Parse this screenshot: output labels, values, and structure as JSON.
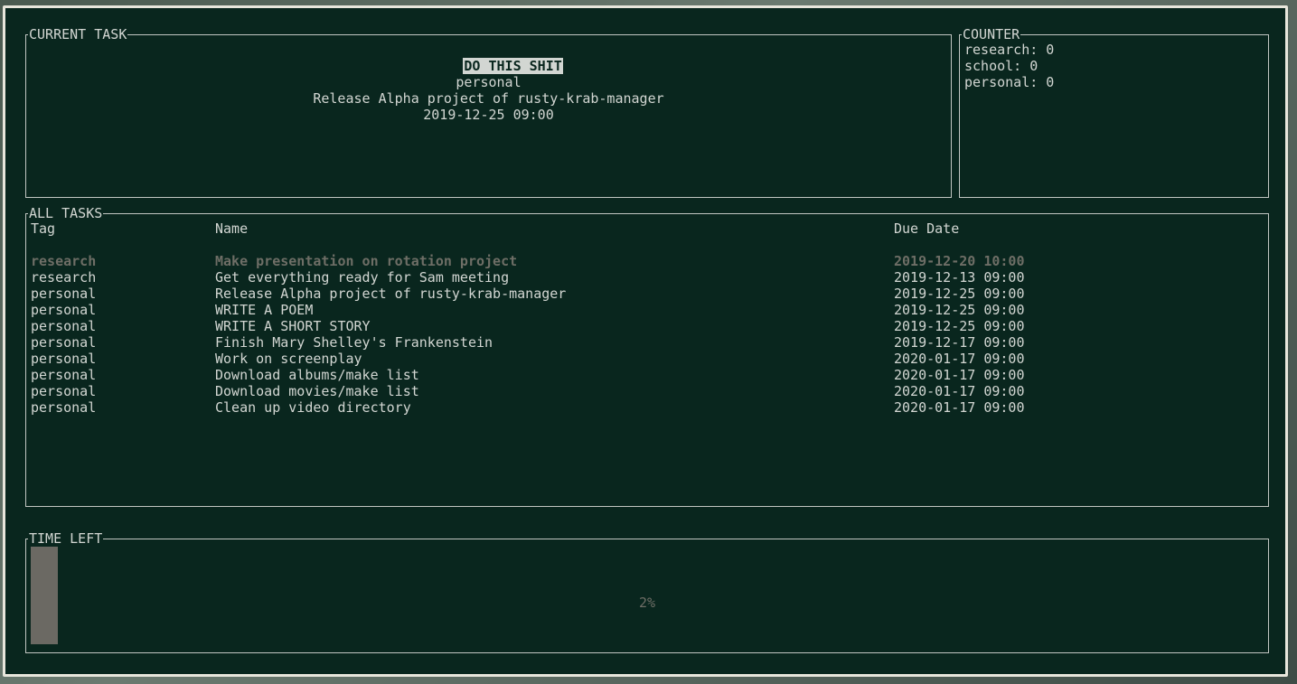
{
  "current_task": {
    "title": "CURRENT TASK",
    "header": "DO THIS SHIT",
    "tag": "personal",
    "name": "Release Alpha project of rusty-krab-manager",
    "due": "2019-12-25 09:00"
  },
  "counter": {
    "title": "COUNTER",
    "items": [
      "research: 0",
      "school: 0",
      "personal: 0"
    ]
  },
  "all_tasks": {
    "title": "ALL TASKS",
    "columns": {
      "tag": "Tag",
      "name": "Name",
      "due": "Due Date"
    },
    "rows": [
      {
        "tag": "research",
        "name": "Make presentation on rotation project",
        "due": "2019-12-20 10:00",
        "selected": true
      },
      {
        "tag": "research",
        "name": "Get everything ready for Sam meeting",
        "due": "2019-12-13 09:00"
      },
      {
        "tag": "personal",
        "name": "Release Alpha project of rusty-krab-manager",
        "due": "2019-12-25 09:00"
      },
      {
        "tag": "personal",
        "name": "WRITE A POEM",
        "due": "2019-12-25 09:00"
      },
      {
        "tag": "personal",
        "name": "WRITE A SHORT STORY",
        "due": "2019-12-25 09:00"
      },
      {
        "tag": "personal",
        "name": "Finish Mary Shelley's Frankenstein",
        "due": "2019-12-17 09:00"
      },
      {
        "tag": "personal",
        "name": "Work on screenplay",
        "due": "2020-01-17 09:00"
      },
      {
        "tag": "personal",
        "name": "Download albums/make list",
        "due": "2020-01-17 09:00"
      },
      {
        "tag": "personal",
        "name": "Download movies/make list",
        "due": "2020-01-17 09:00"
      },
      {
        "tag": "personal",
        "name": "Clean up video directory",
        "due": "2020-01-17 09:00"
      }
    ]
  },
  "time_left": {
    "title": "TIME LEFT",
    "percent_label": "2%",
    "progress": 0.02
  }
}
